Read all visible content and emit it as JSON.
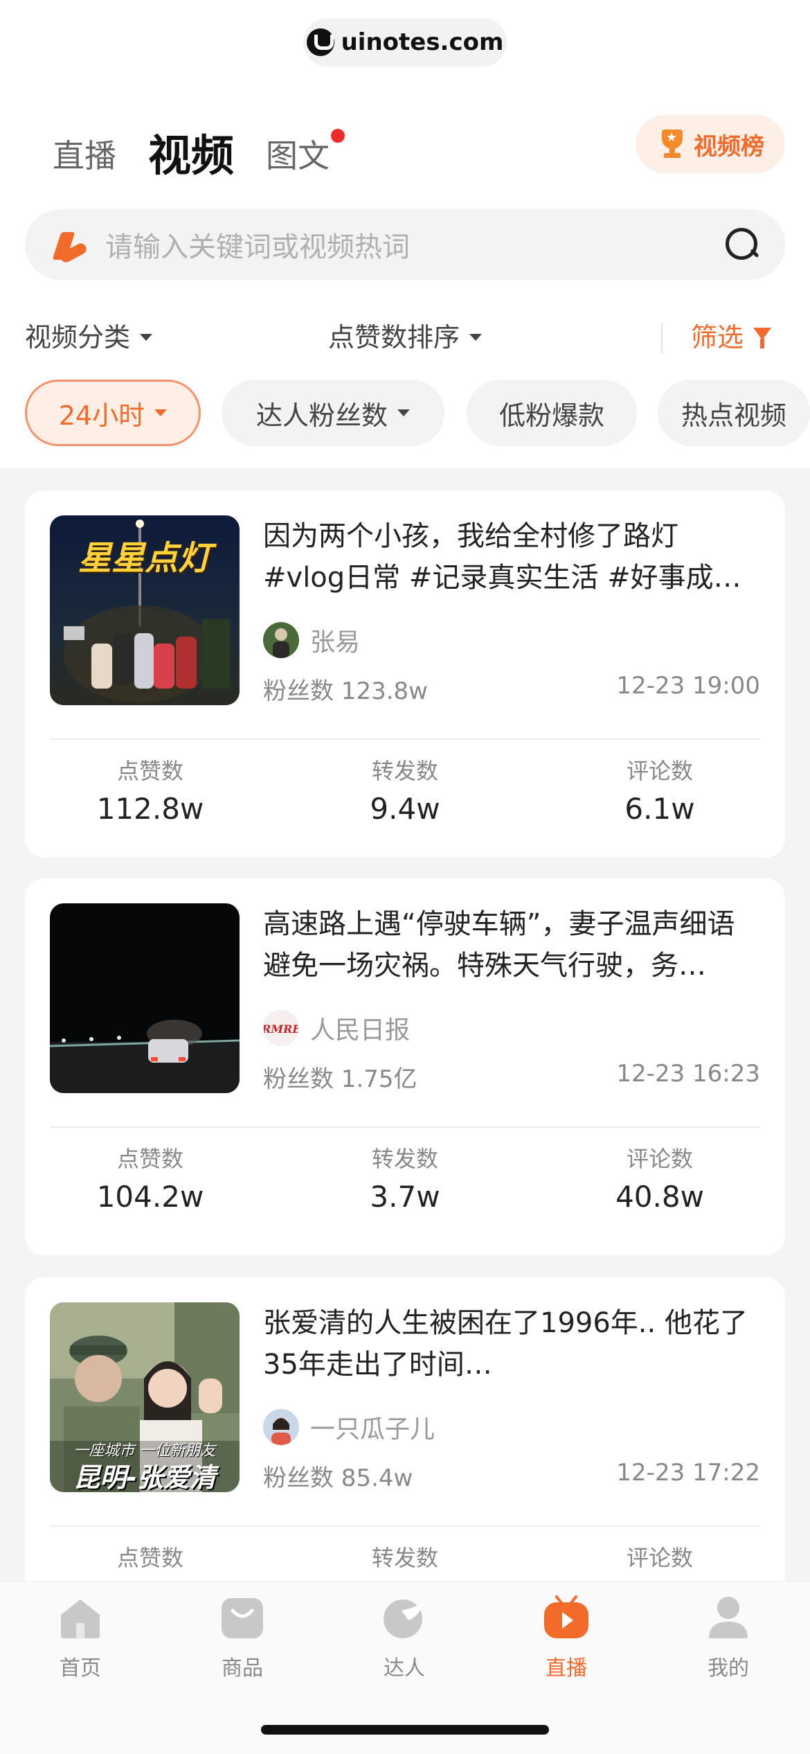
{
  "watermark": {
    "text": "uinotes.com"
  },
  "header": {
    "tabs": [
      {
        "label": "直播"
      },
      {
        "label": "视频"
      },
      {
        "label": "图文"
      }
    ],
    "rank_button": "视频榜"
  },
  "search": {
    "placeholder": "请输入关键词或视频热词"
  },
  "filters": {
    "category": "视频分类",
    "sort": "点赞数排序",
    "screen": "筛选"
  },
  "chips": [
    {
      "label": "24小时"
    },
    {
      "label": "达人粉丝数"
    },
    {
      "label": "低粉爆款"
    },
    {
      "label": "热点视频"
    }
  ],
  "videos": [
    {
      "title": "因为两个小孩，我给全村修了路灯 #vlog日常 #记录真实生活 #好事成…",
      "thumb_caption": "星星点灯",
      "author": "张易",
      "fans": "粉丝数 123.8w",
      "time": "12-23 19:00",
      "stats": [
        {
          "label": "点赞数",
          "value": "112.8w"
        },
        {
          "label": "转发数",
          "value": "9.4w"
        },
        {
          "label": "评论数",
          "value": "6.1w"
        }
      ]
    },
    {
      "title": "高速路上遇“停驶车辆”，妻子温声细语避免一场灾祸。特殊天气行驶，务…",
      "thumb_caption": "",
      "author": "人民日报",
      "fans": "粉丝数 1.75亿",
      "time": "12-23 16:23",
      "stats": [
        {
          "label": "点赞数",
          "value": "104.2w"
        },
        {
          "label": "转发数",
          "value": "3.7w"
        },
        {
          "label": "评论数",
          "value": "40.8w"
        }
      ]
    },
    {
      "title": "张爱清的人生被困在了1996年.. 他花了35年走出了时间…",
      "thumb_caption_top": "一座城市 一位新朋友",
      "thumb_caption_bottom": "昆明-张爱清",
      "author": "一只瓜子儿",
      "fans": "粉丝数 85.4w",
      "time": "12-23 17:22",
      "stats": [
        {
          "label": "点赞数",
          "value": ""
        },
        {
          "label": "转发数",
          "value": ""
        },
        {
          "label": "评论数",
          "value": ""
        }
      ]
    }
  ],
  "bottom_nav": [
    {
      "label": "首页",
      "icon": "home-icon"
    },
    {
      "label": "商品",
      "icon": "bag-icon"
    },
    {
      "label": "达人",
      "icon": "creator-icon"
    },
    {
      "label": "直播",
      "icon": "live-tv-icon"
    },
    {
      "label": "我的",
      "icon": "person-icon"
    }
  ],
  "colors": {
    "accent": "#f26b2a",
    "accent_bg": "#fdeee6",
    "badge_red": "#f02a2a",
    "page_bg": "#f4f4f5"
  }
}
